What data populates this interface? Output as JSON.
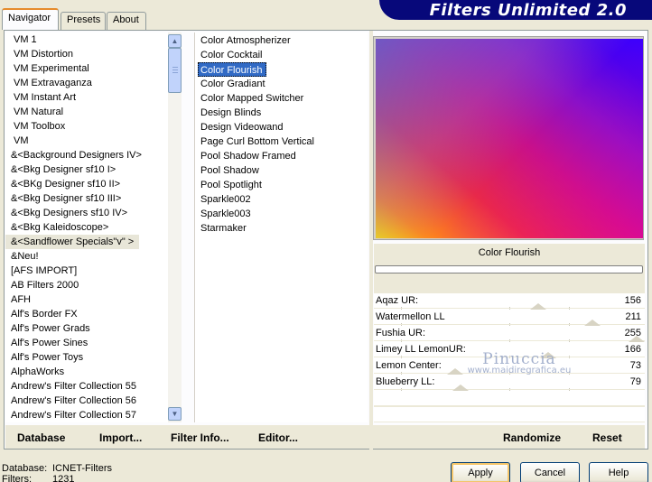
{
  "header": {
    "title": "Filters Unlimited 2.0"
  },
  "tabs": [
    {
      "label": "Navigator",
      "active": true
    },
    {
      "label": "Presets",
      "active": false
    },
    {
      "label": "About",
      "active": false
    }
  ],
  "categories": [
    "VM 1",
    "VM Distortion",
    "VM Experimental",
    "VM Extravaganza",
    "VM Instant Art",
    "VM Natural",
    "VM Toolbox",
    "VM",
    "&<Background Designers IV>",
    "&<Bkg Designer sf10 I>",
    "&<BKg Designer sf10 II>",
    "&<Bkg Designer sf10 III>",
    "&<Bkg Designers sf10 IV>",
    "&<Bkg Kaleidoscope>",
    "&<Sandflower Specials\"v\" >",
    "&Neu!",
    "[AFS IMPORT]",
    "AB Filters 2000",
    "AFH",
    "Alf's Border FX",
    "Alf's Power Grads",
    "Alf's Power Sines",
    "Alf's Power Toys",
    "AlphaWorks",
    "Andrew's Filter Collection 55",
    "Andrew's Filter Collection 56",
    "Andrew's Filter Collection 57"
  ],
  "selected_category": "&<Sandflower Specials\"v\" >",
  "filters": [
    "Color Atmospherizer",
    "Color Cocktail",
    "Color Flourish",
    "Color Gradiant",
    "Color Mapped Switcher",
    "Design Blinds",
    "Design Videowand",
    "Page Curl Bottom Vertical",
    "Pool Shadow Framed",
    "Pool Shadow",
    "Pool Spotlight",
    "Sparkle002",
    "Sparkle003",
    "Starmaker"
  ],
  "selected_filter": "Color Flourish",
  "preview": {
    "filter_name": "Color Flourish",
    "watermark_name": "Pinuccia",
    "watermark_url": "www.maidiregrafica.eu"
  },
  "params": [
    {
      "label": "Aqaz UR:",
      "value": 156,
      "max": 255
    },
    {
      "label": "Watermellon LL",
      "value": 211,
      "max": 255
    },
    {
      "label": "Fushia UR:",
      "value": 255,
      "max": 255
    },
    {
      "label": "Limey LL LemonUR:",
      "value": 166,
      "max": 255
    },
    {
      "label": "Lemon Center:",
      "value": 73,
      "max": 255
    },
    {
      "label": "Blueberry LL:",
      "value": 79,
      "max": 255
    }
  ],
  "toolbar": {
    "database": "Database",
    "import": "Import...",
    "filter_info": "Filter Info...",
    "editor": "Editor...",
    "randomize": "Randomize",
    "reset": "Reset"
  },
  "status": {
    "database_label": "Database:",
    "database_value": "ICNET-Filters",
    "filters_label": "Filters:",
    "filters_value": "1231"
  },
  "buttons": {
    "apply": "Apply",
    "cancel": "Cancel",
    "help": "Help"
  }
}
